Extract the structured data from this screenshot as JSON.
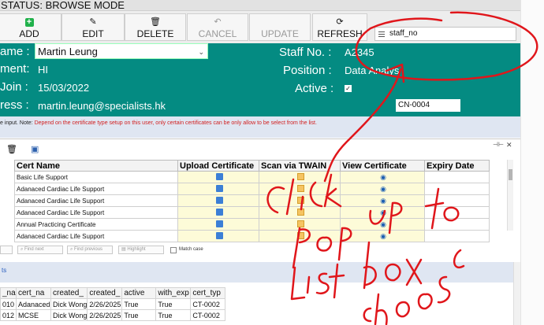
{
  "status": {
    "text": "STATUS: BROWSE MODE"
  },
  "toolbar": {
    "add_label": "ADD",
    "edit_label": "EDIT",
    "delete_label": "DELETE",
    "cancel_label": "CANCEL",
    "update_label": "UPDATE",
    "refresh_label": "REFRESH"
  },
  "staff_select": {
    "value": "staff_no"
  },
  "form": {
    "name_label": "ame :",
    "name_value": "Martin Leung",
    "dept_label": "ment:",
    "dept_value": "HI",
    "join_label": "Join :",
    "join_value": "15/03/2022",
    "email_label": "ress :",
    "email_value": "martin.leung@specialists.hk",
    "staffno_label": "Staff No. :",
    "staffno_value": "A2345",
    "position_label": "Position :",
    "position_value": "Data Analys",
    "active_label": "Active :",
    "active_check": "✓",
    "cn_value": "CN-0004"
  },
  "note": {
    "prefix": "e input. Note: ",
    "text": "Depend on the certificate type setup on this user, only certain certificates can be only allow to be select from the list."
  },
  "cert_grid": {
    "columns": [
      "Cert Name",
      "Upload Certificate",
      "Scan via TWAIN",
      "View Certificate",
      "Expiry Date"
    ],
    "rows": [
      {
        "name": "Basic Life Support"
      },
      {
        "name": "Adanaced Cardiac Life Support"
      },
      {
        "name": "Adanaced Cardiac Life Support"
      },
      {
        "name": "Adanaced Cardiac Life Support"
      },
      {
        "name": "Annual Practicing Certificate"
      },
      {
        "name": "Adanaced Cardiac Life Support"
      }
    ]
  },
  "find_bar": {
    "find_next": "Find next",
    "find_previous": "Find previous",
    "highlight": "Highlight",
    "match_case": "Match case"
  },
  "bottom": {
    "header_text": "ts",
    "columns": [
      "_na",
      "cert_na",
      "created_",
      "created_",
      "active",
      "with_exp",
      "cert_typ"
    ],
    "rows": [
      [
        "010",
        "Adanaced",
        "Dick Wong",
        "2/26/2025",
        "True",
        "True",
        "CT-0002"
      ],
      [
        "012",
        "MCSE",
        "Dick Wong",
        "2/26/2025",
        "True",
        "True",
        "CT-0002"
      ]
    ]
  },
  "annotation": {
    "handwriting": "click pop up list box to choose",
    "color": "#e0161b"
  }
}
